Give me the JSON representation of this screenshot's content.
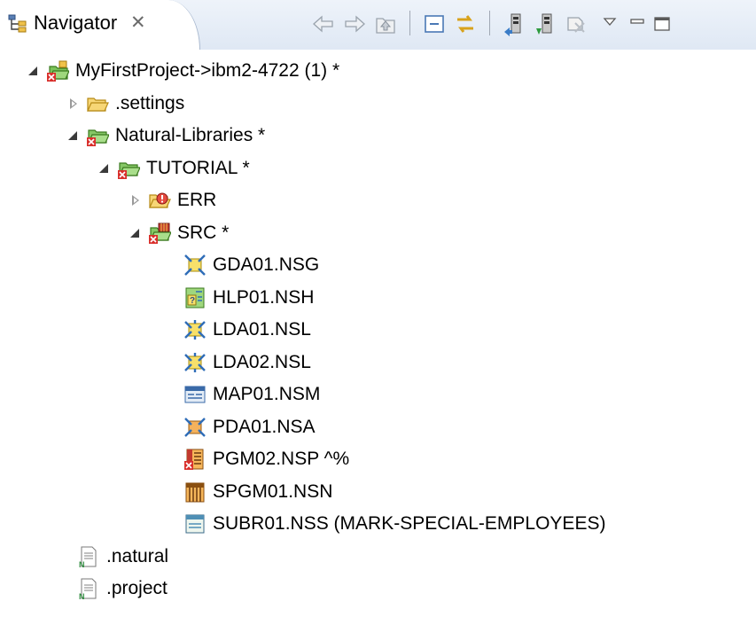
{
  "view": {
    "title": "Navigator",
    "close_glyph": "✕",
    "toolbar": [
      {
        "name": "back-icon"
      },
      {
        "name": "forward-icon"
      },
      {
        "name": "up-icon"
      },
      {
        "name": "collapse-all-icon"
      },
      {
        "name": "link-with-editor-icon"
      },
      {
        "name": "upload-icon"
      },
      {
        "name": "download-icon"
      },
      {
        "name": "sync-icon"
      },
      {
        "name": "view-menu-icon"
      },
      {
        "name": "minimize-icon"
      },
      {
        "name": "maximize-icon"
      }
    ]
  },
  "tree": [
    {
      "label": "MyFirstProject->ibm2-4722 (1) *",
      "icon": "project-icon",
      "expander": "open"
    },
    {
      "label": ".settings",
      "icon": "folder-icon",
      "expander": "closed"
    },
    {
      "label": "Natural-Libraries *",
      "icon": "libraries-folder-icon",
      "expander": "open"
    },
    {
      "label": "TUTORIAL *",
      "icon": "library-folder-icon",
      "expander": "open"
    },
    {
      "label": "ERR",
      "icon": "error-folder-icon",
      "expander": "closed"
    },
    {
      "label": "SRC *",
      "icon": "source-folder-icon",
      "expander": "open"
    },
    {
      "label": "GDA01.NSG",
      "icon": "global-data-area-icon",
      "expander": "none"
    },
    {
      "label": "HLP01.NSH",
      "icon": "helproutine-icon",
      "expander": "none"
    },
    {
      "label": "LDA01.NSL",
      "icon": "local-data-area-icon",
      "expander": "none"
    },
    {
      "label": "LDA02.NSL",
      "icon": "local-data-area-icon",
      "expander": "none"
    },
    {
      "label": "MAP01.NSM",
      "icon": "map-icon",
      "expander": "none"
    },
    {
      "label": "PDA01.NSA",
      "icon": "parameter-data-area-icon",
      "expander": "none"
    },
    {
      "label": "PGM02.NSP  ^%",
      "icon": "program-icon",
      "expander": "none"
    },
    {
      "label": "SPGM01.NSN",
      "icon": "subprogram-icon",
      "expander": "none"
    },
    {
      "label": "SUBR01.NSS (MARK-SPECIAL-EMPLOYEES)",
      "icon": "subroutine-icon",
      "expander": "none"
    },
    {
      "label": ".natural",
      "icon": "natural-file-icon",
      "expander": "none"
    },
    {
      "label": ".project",
      "icon": "natural-file-icon",
      "expander": "none"
    }
  ]
}
